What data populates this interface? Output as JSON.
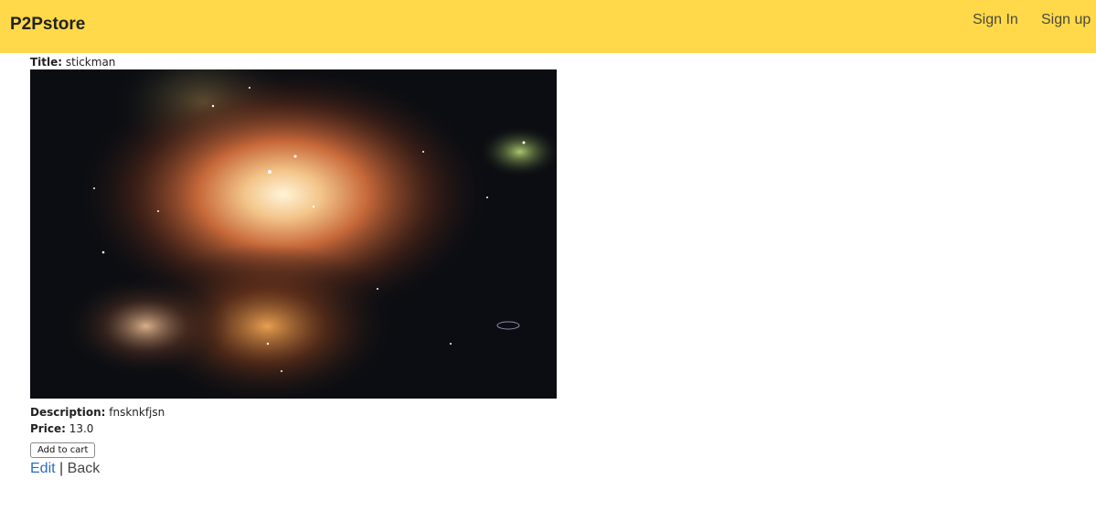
{
  "navbar": {
    "brand": "P2Pstore",
    "sign_in": "Sign In",
    "sign_up": "Sign up",
    "background_color": "#ffd94a"
  },
  "product": {
    "title_label": "Title:",
    "title": "stickman",
    "description_label": "Description:",
    "description": "fnsknkfjsn",
    "price_label": "Price:",
    "price": "13.0",
    "image_alt": "nebula-space-image"
  },
  "actions": {
    "add_to_cart": "Add to cart",
    "edit": "Edit",
    "separator": "|",
    "back": "Back",
    "link_color": "#2b6cc4"
  }
}
